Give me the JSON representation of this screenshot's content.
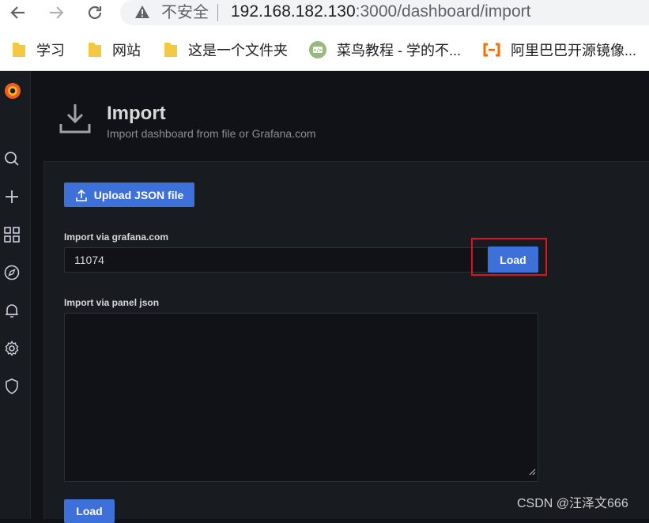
{
  "browser": {
    "insecure_label": "不安全",
    "url_host": "192.168.182.130",
    "url_rest": ":3000/dashboard/import",
    "bookmarks": [
      {
        "label": "学习",
        "icon": "folder-icon"
      },
      {
        "label": "网站",
        "icon": "folder-icon"
      },
      {
        "label": "这是一个文件夹",
        "icon": "folder-icon"
      },
      {
        "label": "菜鸟教程 - 学的不...",
        "icon": "runoob-icon"
      },
      {
        "label": "阿里巴巴开源镜像...",
        "icon": "aliyun-icon"
      }
    ]
  },
  "sidemenu": {
    "items": [
      "grafana-logo-icon",
      "search-icon",
      "plus-icon",
      "dashboards-icon",
      "explore-icon",
      "alerting-icon",
      "configuration-icon",
      "shield-icon"
    ]
  },
  "header": {
    "title": "Import",
    "subtitle": "Import dashboard from file or Grafana.com"
  },
  "form": {
    "upload_label": "Upload JSON file",
    "gcom_label": "Import via grafana.com",
    "gcom_value": "11074",
    "load_label": "Load",
    "panel_json_label": "Import via panel json",
    "panel_json_value": "",
    "submit_label": "Load"
  },
  "watermark": "CSDN @汪泽文666",
  "colors": {
    "primary": "#3d71d9",
    "highlight": "#e0101f",
    "background": "#111217"
  }
}
